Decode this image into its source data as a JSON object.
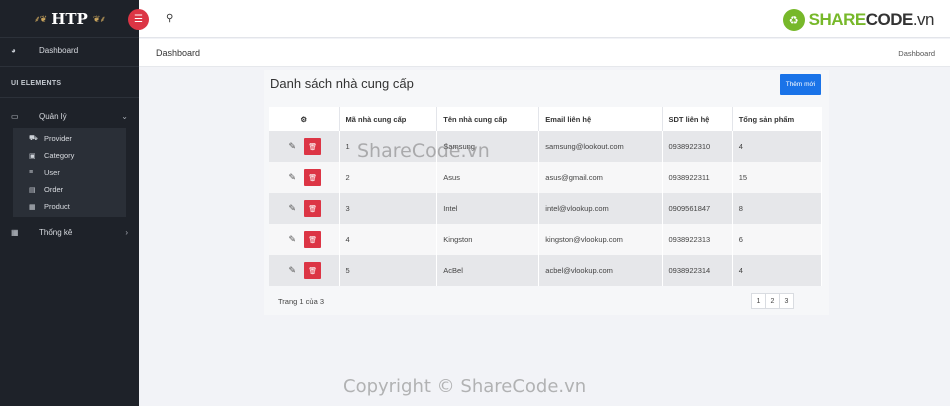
{
  "brand": {
    "name": "HTP"
  },
  "sidebar": {
    "dashboard_label": "Dashboard",
    "section_title": "UI ELEMENTS",
    "manage_label": "Quản lý",
    "submenu": [
      {
        "label": "Provider",
        "icon": "truck-icon"
      },
      {
        "label": "Category",
        "icon": "book-icon"
      },
      {
        "label": "User",
        "icon": "list-icon"
      },
      {
        "label": "Order",
        "icon": "order-icon"
      },
      {
        "label": "Product",
        "icon": "product-icon"
      }
    ],
    "stats_label": "Thống kê"
  },
  "topbar": {
    "logo_share": "SHARE",
    "logo_code": "CODE",
    "logo_tld": ".vn"
  },
  "breadcrumb": {
    "title": "Dashboard",
    "right": "Dashboard"
  },
  "main": {
    "title": "Danh sách nhà cung cấp",
    "add_button": "Thêm mới",
    "columns": [
      "Mã nhà cung cấp",
      "Tên nhà cung cấp",
      "Email liên hệ",
      "SDT liên hệ",
      "Tổng sản phẩm"
    ],
    "rows": [
      {
        "id": "1",
        "name": "Samsung",
        "email": "samsung@lookout.com",
        "phone": "0938922310",
        "total": "4"
      },
      {
        "id": "2",
        "name": "Asus",
        "email": "asus@gmail.com",
        "phone": "0938922311",
        "total": "15"
      },
      {
        "id": "3",
        "name": "Intel",
        "email": "intel@vlookup.com",
        "phone": "0909561847",
        "total": "8"
      },
      {
        "id": "4",
        "name": "Kingston",
        "email": "kingston@vlookup.com",
        "phone": "0938922313",
        "total": "6"
      },
      {
        "id": "5",
        "name": "AcBel",
        "email": "acbel@vlookup.com",
        "phone": "0938922314",
        "total": "4"
      }
    ],
    "pagination_text": "Trang 1 của 3",
    "pages": [
      "1",
      "2",
      "3"
    ]
  },
  "watermark": "ShareCode.vn",
  "copyright": "Copyright © ShareCode.vn"
}
